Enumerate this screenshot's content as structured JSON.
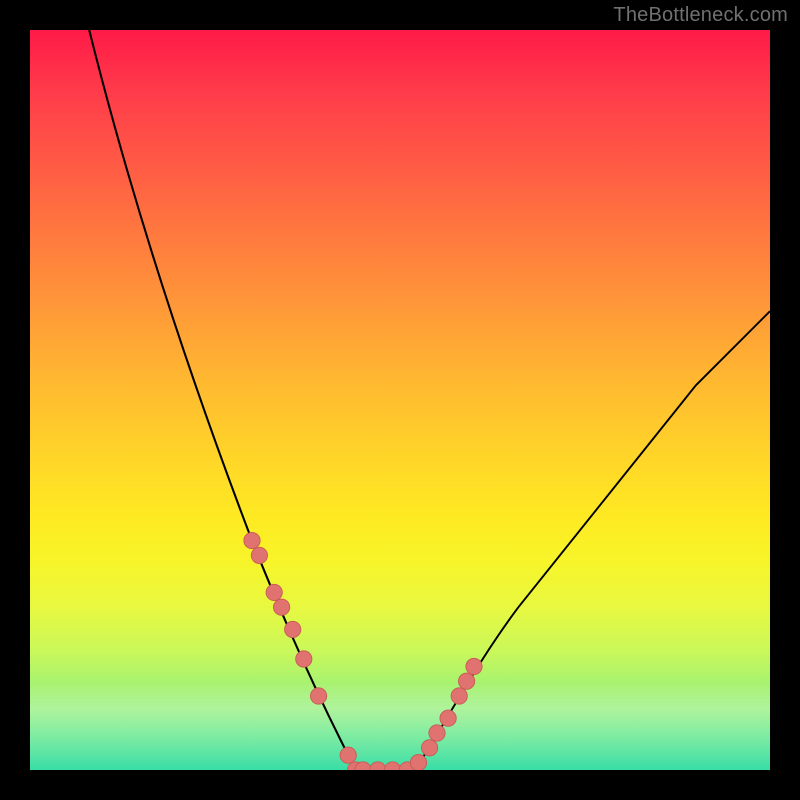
{
  "watermark": "TheBottleneck.com",
  "colors": {
    "frame_bg": "#000000",
    "gradient_top": "#ff1a47",
    "gradient_bottom": "#1fd7a0",
    "curve": "#000000",
    "marker_fill": "#e0736f",
    "marker_stroke": "#c75a56",
    "highlight_band": "rgba(255,255,200,0.35)"
  },
  "chart_data": {
    "type": "line",
    "title": "",
    "xlabel": "",
    "ylabel": "",
    "xlim": [
      0,
      100
    ],
    "ylim": [
      0,
      100
    ],
    "grid": false,
    "description": "V-shaped bottleneck curve over rainbow gradient; minimum (0%) near middle, rising steeply to either side. Left branch reaches ~100 at x≈8; right branch reaches ~62 at x=100.",
    "series": [
      {
        "name": "left-branch",
        "x": [
          8,
          12,
          16,
          20,
          24,
          28,
          30,
          32,
          34,
          36,
          38,
          40,
          42,
          43,
          44
        ],
        "y": [
          100,
          82,
          67,
          55,
          45,
          36,
          31,
          27,
          22,
          17,
          12,
          8,
          4,
          2,
          0
        ]
      },
      {
        "name": "floor",
        "x": [
          44,
          46,
          48,
          50,
          52
        ],
        "y": [
          0,
          0,
          0,
          0,
          0
        ]
      },
      {
        "name": "right-branch",
        "x": [
          52,
          54,
          56,
          58,
          60,
          64,
          68,
          72,
          76,
          80,
          84,
          88,
          92,
          96,
          100
        ],
        "y": [
          0,
          2,
          5,
          8,
          12,
          18,
          24,
          30,
          35,
          41,
          46,
          51,
          55,
          59,
          62
        ]
      }
    ],
    "markers": {
      "name": "sample-points",
      "x": [
        30,
        31,
        33,
        34,
        35.5,
        37,
        39,
        43,
        44,
        45,
        47,
        49,
        51,
        52.5,
        54,
        55,
        56.5,
        58,
        59,
        60
      ],
      "y": [
        31,
        29,
        24,
        22,
        19,
        15,
        10,
        2,
        0,
        0,
        0,
        0,
        0,
        1,
        3,
        5,
        7,
        10,
        12,
        14
      ]
    },
    "highlight_band_y": [
      0,
      12
    ]
  }
}
